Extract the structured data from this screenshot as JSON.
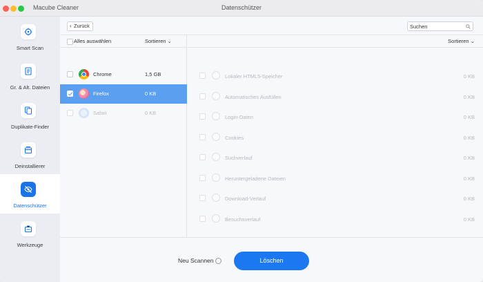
{
  "titlebar": {
    "app_name": "Macube Cleaner",
    "window_title": "Datenschützer"
  },
  "sidebar": {
    "items": [
      {
        "label": "Smart Scan",
        "icon": "target-icon"
      },
      {
        "label": "Gr. & Alt. Dateien",
        "icon": "document-icon"
      },
      {
        "label": "Duplikate-Finder",
        "icon": "duplicate-icon"
      },
      {
        "label": "Deinstallierer",
        "icon": "box-icon"
      },
      {
        "label": "Datenschützer",
        "icon": "eye-off-icon",
        "active": true
      },
      {
        "label": "Werkzeuge",
        "icon": "toolbox-icon"
      }
    ]
  },
  "toolbar": {
    "back_label": "Zurück",
    "search_placeholder": "Suchen"
  },
  "browser_list": {
    "select_all_label": "Alles auswählen",
    "sort_label": "Sortieren",
    "rows": [
      {
        "name": "Chrome",
        "size": "1,5 GB",
        "state": "normal"
      },
      {
        "name": "Firefox",
        "size": "0 KB",
        "state": "selected"
      },
      {
        "name": "Safari",
        "size": "0 KB",
        "state": "disabled"
      }
    ]
  },
  "item_list": {
    "sort_label": "Sortieren",
    "rows": [
      {
        "label": "Lokaler HTML5-Speicher",
        "size": "0 KB"
      },
      {
        "label": "Automatisches Ausfüllen",
        "size": "0 KB"
      },
      {
        "label": "Login-Daten",
        "size": "0 KB"
      },
      {
        "label": "Cookies",
        "size": "0 KB"
      },
      {
        "label": "Suchverlauf",
        "size": "0 KB"
      },
      {
        "label": "Heruntergeladene Dateien",
        "size": "0 KB"
      },
      {
        "label": "Download-Verlauf",
        "size": "0 KB"
      },
      {
        "label": "Besuchsverlauf",
        "size": "0 KB"
      }
    ]
  },
  "footer": {
    "rescan_label": "Neu Scannen",
    "delete_label": "Löschen"
  },
  "colors": {
    "accent": "#1c78f0",
    "selected_row": "#5b9ff0"
  }
}
